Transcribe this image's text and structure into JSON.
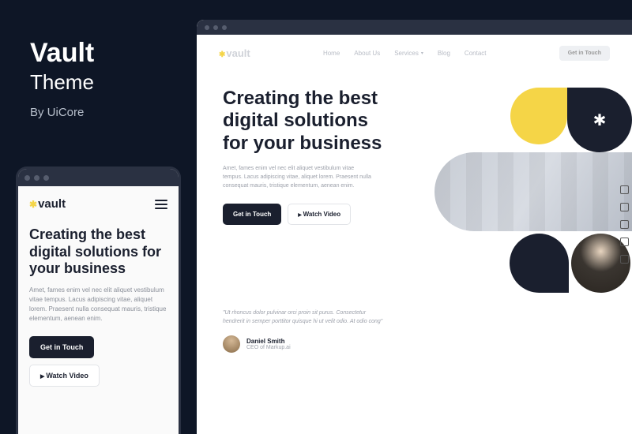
{
  "promo": {
    "title": "Vault",
    "subtitle": "Theme",
    "byline": "By UiCore"
  },
  "brand": {
    "name": "vault"
  },
  "nav": {
    "items": [
      "Home",
      "About Us",
      "Services",
      "Blog",
      "Contact"
    ],
    "cta": "Get in Touch"
  },
  "hero": {
    "headline": "Creating the best digital solutions for your business",
    "body": "Amet, fames enim vel nec elit aliquet vestibulum vitae tempus. Lacus adipiscing vitae, aliquet lorem. Praesent nulla consequat mauris, tristique elementum, aenean enim.",
    "primary_cta": "Get in Touch",
    "secondary_cta": "Watch Video"
  },
  "testimonial": {
    "quote": "\"Ut rhoncus dolor pulvinar orci proin sit purus. Consectetur hendrerit in semper porttitor quisque hi ut velit odio. At odio cong\"",
    "author_name": "Daniel Smith",
    "author_title": "CEO of Markup.ai"
  },
  "mobile": {
    "body": "Amet, fames enim vel nec elit aliquet vestibulum vitae tempus. Lacus adipiscing vitae, aliquet lorem. Praesent nulla consequat mauris, tristique elementum, aenean enim."
  }
}
